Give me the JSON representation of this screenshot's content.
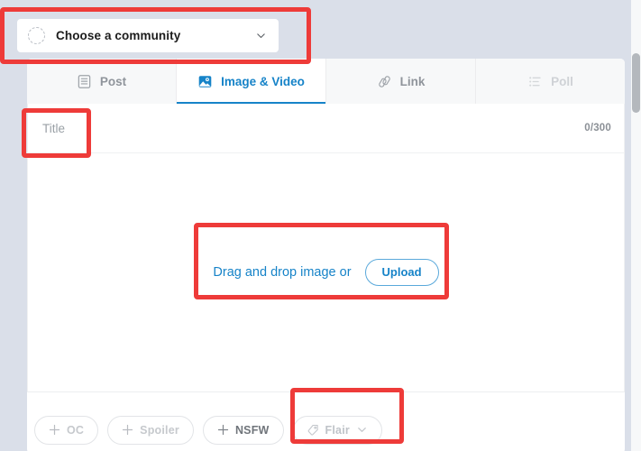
{
  "community": {
    "label": "Choose a community",
    "avatar_icon": "dashed-circle-avatar",
    "chevron_icon": "chevron-down-icon"
  },
  "tabs": [
    {
      "id": "post",
      "label": "Post",
      "icon": "document-lines-icon",
      "state": "inactive"
    },
    {
      "id": "image",
      "label": "Image & Video",
      "icon": "image-photo-icon",
      "state": "active"
    },
    {
      "id": "link",
      "label": "Link",
      "icon": "chain-link-icon",
      "state": "inactive"
    },
    {
      "id": "poll",
      "label": "Poll",
      "icon": "poll-list-icon",
      "state": "disabled"
    }
  ],
  "title_field": {
    "value": "",
    "placeholder": "Title",
    "counter": "0/300"
  },
  "dropzone": {
    "text": "Drag and drop image or",
    "upload_label": "Upload"
  },
  "options": [
    {
      "id": "oc",
      "label": "OC",
      "icon": "plus-icon",
      "style": "dim"
    },
    {
      "id": "spoiler",
      "label": "Spoiler",
      "icon": "plus-icon",
      "style": "dim"
    },
    {
      "id": "nsfw",
      "label": "NSFW",
      "icon": "plus-icon",
      "style": "solid"
    }
  ],
  "flair": {
    "label": "Flair",
    "tag_icon": "tag-icon",
    "chevron_icon": "chevron-down-icon"
  },
  "scrollbar": {
    "name": "vertical-scrollbar"
  },
  "annotations": [
    {
      "id": "community",
      "target": "choose-a-community-selector"
    },
    {
      "id": "title",
      "target": "title-input"
    },
    {
      "id": "dropzone",
      "target": "drag-and-drop-area"
    },
    {
      "id": "flair",
      "target": "flair-button"
    }
  ],
  "colors": {
    "accent": "#1683c8",
    "page_bg": "#dadfe9",
    "annotation": "#ee3b39",
    "muted_text": "#8f949b"
  }
}
